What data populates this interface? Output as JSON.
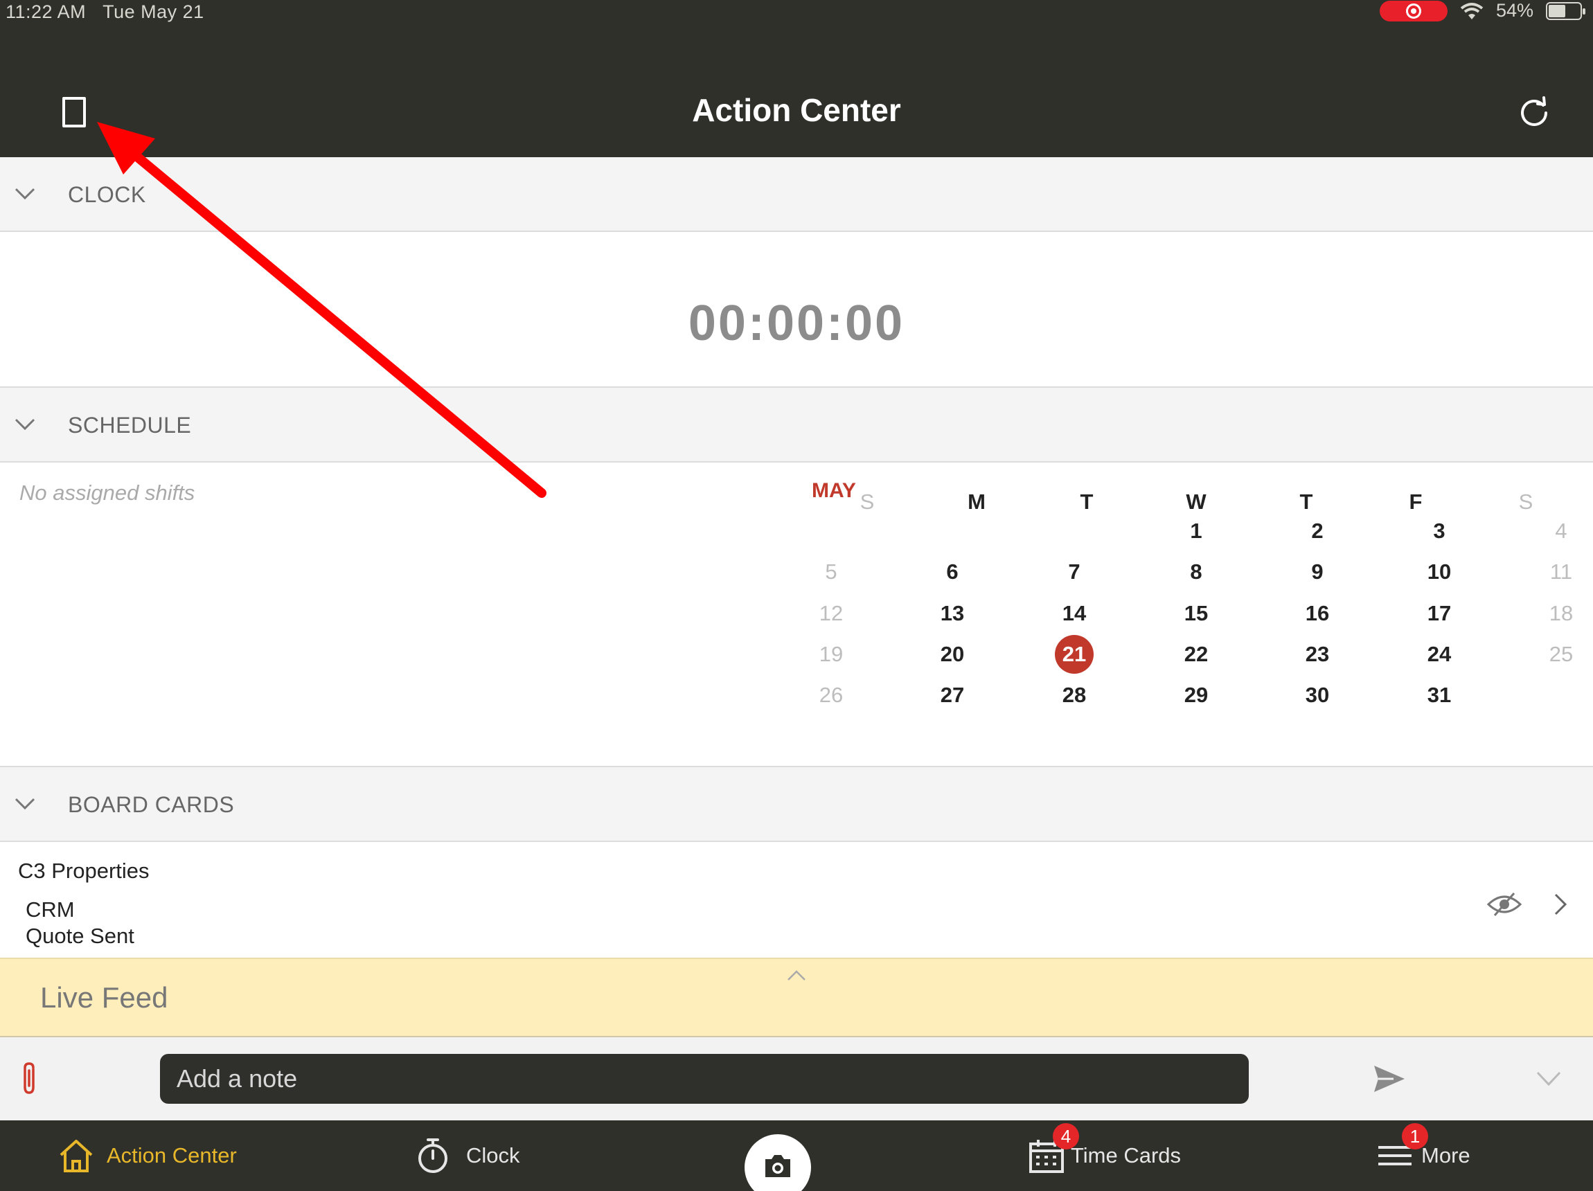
{
  "status_bar": {
    "time": "11:22 AM",
    "date": "Tue May 21",
    "battery": "54%",
    "battery_level": 0.54
  },
  "header": {
    "title": "Action Center",
    "left_icon": "tablet-icon",
    "right_icon": "refresh-icon"
  },
  "sections": {
    "clock": {
      "label": "CLOCK",
      "value": "00:00:00"
    },
    "schedule": {
      "label": "SCHEDULE",
      "empty_text": "No assigned shifts",
      "calendar": {
        "month": "MAY",
        "weekdays": [
          "S",
          "M",
          "T",
          "W",
          "T",
          "F",
          "S"
        ],
        "today": "21",
        "weeks": [
          [
            "",
            "",
            "",
            "1",
            "2",
            "3",
            "4"
          ],
          [
            "5",
            "6",
            "7",
            "8",
            "9",
            "10",
            "11"
          ],
          [
            "12",
            "13",
            "14",
            "15",
            "16",
            "17",
            "18"
          ],
          [
            "19",
            "20",
            "21",
            "22",
            "23",
            "24",
            "25"
          ],
          [
            "26",
            "27",
            "28",
            "29",
            "30",
            "31",
            ""
          ]
        ]
      }
    },
    "board_cards": {
      "label": "BOARD CARDS",
      "card": {
        "company": "C3 Properties",
        "board": "CRM",
        "stage": "Quote Sent"
      }
    }
  },
  "live_feed": {
    "label": "Live Feed"
  },
  "note": {
    "placeholder": "Add a note"
  },
  "tabs": [
    {
      "label": "Action Center",
      "icon": "home-icon",
      "active": true
    },
    {
      "label": "Clock",
      "icon": "stopwatch-icon"
    },
    {
      "label": "",
      "icon": "camera-icon"
    },
    {
      "label": "Time Cards",
      "icon": "calendar-icon",
      "badge": "4"
    },
    {
      "label": "More",
      "icon": "menu-icon",
      "badge": "1"
    }
  ],
  "colors": {
    "header_bg": "#30302b",
    "accent": "#c0392b",
    "active_tab": "#e8b82a",
    "live_feed_bg": "#fdeebb",
    "annotation_arrow": "#ff0000"
  }
}
